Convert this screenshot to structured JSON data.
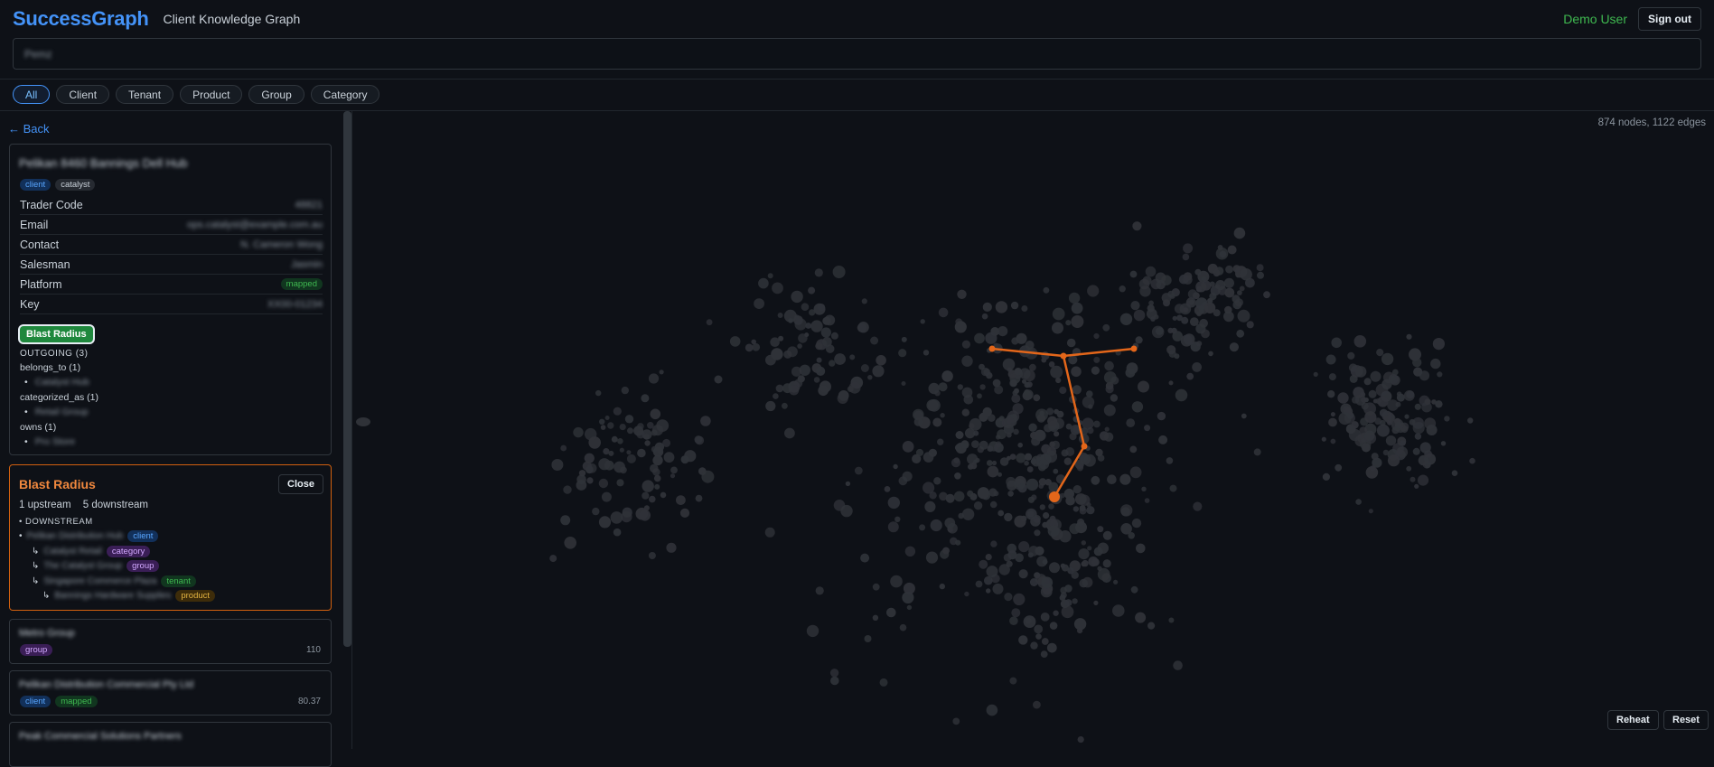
{
  "app": {
    "brand": "SuccessGraph",
    "subtitle": "Client Knowledge Graph",
    "user": "Demo User",
    "signout": "Sign out"
  },
  "search": {
    "value": "Pemz"
  },
  "filters": [
    "All",
    "Client",
    "Tenant",
    "Product",
    "Group",
    "Category"
  ],
  "active_filter": "All",
  "back": "← Back",
  "detail": {
    "title": "Pelikan 8460 Bannings Dell Hub",
    "tags": [
      "client",
      "catalyst"
    ],
    "fields": [
      {
        "label": "Trader Code",
        "value": "48821"
      },
      {
        "label": "Email",
        "value": "ops.catalyst@example.com.au"
      },
      {
        "label": "Contact",
        "value": "N. Cameron Wong"
      },
      {
        "label": "Salesman",
        "value": "Jasmin"
      },
      {
        "label": "Platform",
        "value": "mapped",
        "is_tag": true
      },
      {
        "label": "Key",
        "value": "XX00-01234"
      }
    ],
    "blast_button": "Blast Radius",
    "outgoing_label": "OUTGOING (3)",
    "relations": [
      {
        "label": "belongs_to (1)",
        "item": "Catalyst Hub"
      },
      {
        "label": "categorized_as (1)",
        "item": "Retail Group"
      },
      {
        "label": "owns (1)",
        "item": "Pro Store"
      }
    ]
  },
  "blast": {
    "title": "Blast Radius",
    "close": "Close",
    "upstream": "1 upstream",
    "downstream": "5 downstream",
    "section": "• DOWNSTREAM",
    "arrow": "↳",
    "items": [
      {
        "name": "Pelikan Distribution Hub",
        "tag": "client",
        "indent": 0
      },
      {
        "name": "Catalyst Retail",
        "tag": "category",
        "indent": 1
      },
      {
        "name": "The Catalyst Group",
        "tag": "group",
        "indent": 1
      },
      {
        "name": "Singapore Commerce Plaza",
        "tag": "tenant",
        "indent": 1
      },
      {
        "name": "Bannings Hardware Supplies",
        "tag": "product",
        "indent": 2
      }
    ]
  },
  "list_cards": [
    {
      "name": "Metro Group",
      "tags": [
        "group"
      ],
      "value": "110"
    },
    {
      "name": "Pelikan Distribution Commercial Pty Ltd",
      "tags": [
        "client",
        "mapped"
      ],
      "value": "80.37"
    },
    {
      "name": "Peak Commercial Solutions Partners",
      "tags": [],
      "value": ""
    }
  ],
  "graph": {
    "counts": "874 nodes, 1122 edges",
    "reheat": "Reheat",
    "reset": "Reset",
    "node_color": "#2f3238",
    "highlight_color": "#e3661a"
  }
}
